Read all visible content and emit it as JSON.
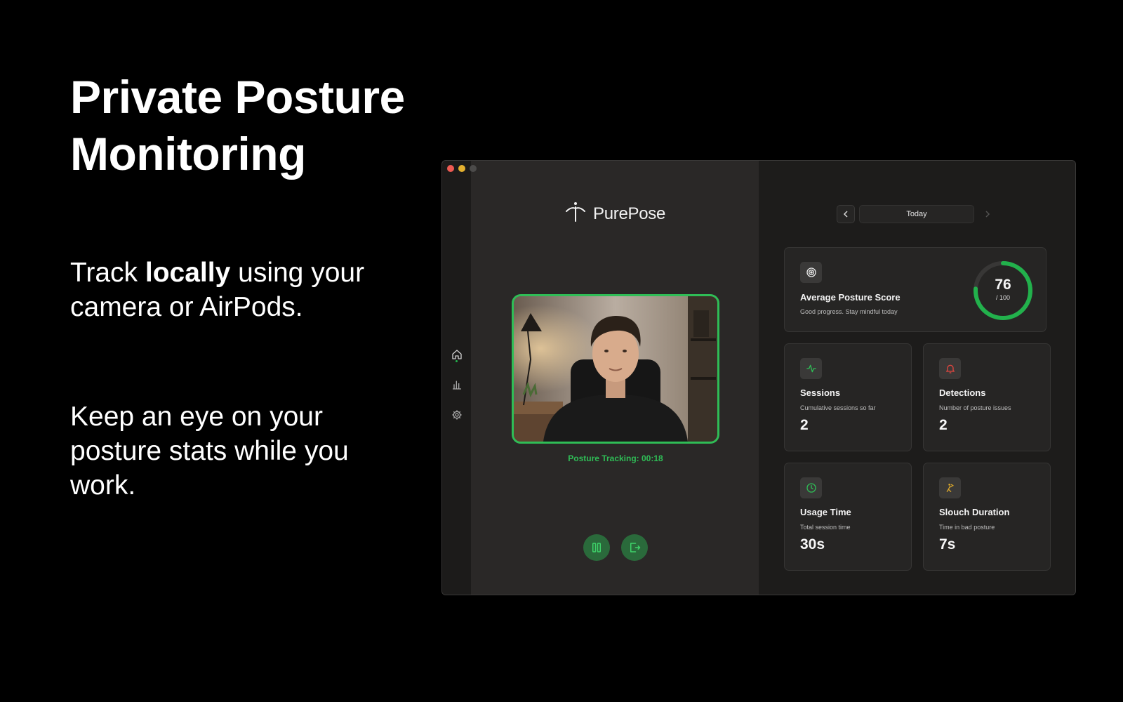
{
  "marketing": {
    "headline": "Private Posture Monitoring",
    "copy1": {
      "before": "Track ",
      "bold": "locally",
      "after": " using your camera or AirPods."
    },
    "copy2": "Keep an eye on your posture stats while you work."
  },
  "app": {
    "name": "PurePose",
    "sidebar": [
      {
        "id": "home",
        "icon": "home-icon",
        "active": true
      },
      {
        "id": "stats",
        "icon": "bar-chart-icon",
        "active": false
      },
      {
        "id": "settings",
        "icon": "gear-icon",
        "active": false
      }
    ],
    "camera": {
      "tracking_label": "Posture Tracking: 00:18"
    },
    "controls": [
      {
        "id": "pause",
        "icon": "pause-icon"
      },
      {
        "id": "exit",
        "icon": "exit-icon"
      }
    ],
    "date_nav": {
      "label": "Today",
      "prev_icon": "chevron-left-icon",
      "next_icon": "chevron-right-icon"
    },
    "score": {
      "title": "Average Posture Score",
      "subtitle": "Good progress. Stay mindful today",
      "value": "76",
      "max": "/ 100",
      "fraction": 0.76,
      "icon": "target-icon"
    },
    "stats": {
      "sessions": {
        "title": "Sessions",
        "subtitle": "Cumulative sessions so far",
        "value": "2",
        "icon": "activity-icon"
      },
      "detections": {
        "title": "Detections",
        "subtitle": "Number of posture issues",
        "value": "2",
        "icon": "bell-icon"
      },
      "usage": {
        "title": "Usage Time",
        "subtitle": "Total session time",
        "value": "30s",
        "icon": "clock-icon"
      },
      "slouch": {
        "title": "Slouch Duration",
        "subtitle": "Time in bad posture",
        "value": "7s",
        "icon": "slouch-icon"
      }
    },
    "colors": {
      "accent": "#2fbd56",
      "detections": "#e0463f",
      "slouch": "#d9a62b",
      "window_bg": "#232221"
    }
  }
}
